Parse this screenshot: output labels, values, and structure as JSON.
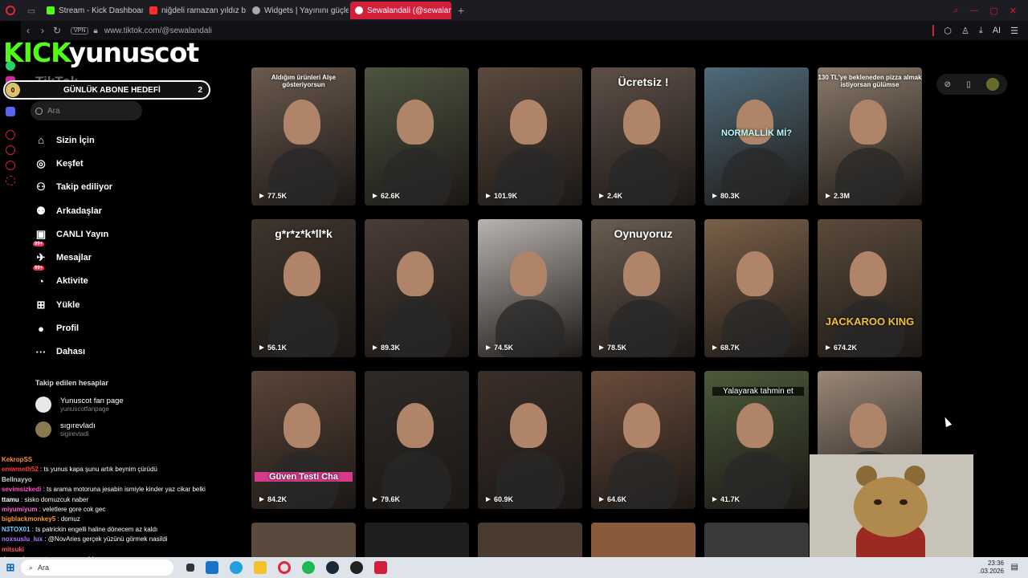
{
  "browser": {
    "tabs": [
      {
        "label": "Stream - Kick Dashboard",
        "color": "#53fc18"
      },
      {
        "label": "niğdeli ramazan yıldız bir b",
        "color": "#ff2d2d"
      },
      {
        "label": "Widgets | Yayınını güçlend",
        "color": "#cccccc"
      },
      {
        "label": "Sewalandali (@sewalandali",
        "color": "#ffffff"
      }
    ],
    "new_tab": "+",
    "vpn": "VPN",
    "url": "www.tiktok.com/@sewalandali",
    "ai_label": "AI"
  },
  "overlay": {
    "kick_logo": "KICK",
    "streamer": "yunuscot",
    "goal_label": "GÜNLÜK ABONE HEDEFİ",
    "goal_current": "0",
    "goal_target": "2"
  },
  "tiktok": {
    "brand": "TikTok",
    "search_placeholder": "Ara",
    "nav": [
      {
        "label": "Sizin İçin",
        "icon": "home-icon",
        "glyph": "⌂"
      },
      {
        "label": "Keşfet",
        "icon": "compass-icon",
        "glyph": "◎"
      },
      {
        "label": "Takip ediliyor",
        "icon": "following-icon",
        "glyph": "⚇"
      },
      {
        "label": "Arkadaşlar",
        "icon": "friends-icon",
        "glyph": "⚉"
      },
      {
        "label": "CANLI Yayın",
        "icon": "live-icon",
        "glyph": "▣"
      },
      {
        "label": "Mesajlar",
        "icon": "messages-icon",
        "glyph": "✈",
        "badge": "99+"
      },
      {
        "label": "Aktivite",
        "icon": "activity-icon",
        "glyph": "◔",
        "badge": "99+"
      },
      {
        "label": "Yükle",
        "icon": "upload-icon",
        "glyph": "⊞"
      },
      {
        "label": "Profil",
        "icon": "profile-icon",
        "glyph": "●"
      },
      {
        "label": "Dahası",
        "icon": "more-icon",
        "glyph": "···"
      }
    ],
    "following_title": "Takip edilen hesaplar",
    "accounts": [
      {
        "name": "Yunuscot fan page",
        "handle": "yunuscotfanpage"
      },
      {
        "name": "sıgırevladı",
        "handle": "sigirevladi"
      }
    ]
  },
  "videos": [
    {
      "views": "77.5K",
      "caption": "Aldığım ürünleri Alşe gösteriyorsun",
      "bg": "#6b5a4e"
    },
    {
      "views": "62.6K",
      "caption": "",
      "bg": "#4d5440"
    },
    {
      "views": "101.9K",
      "caption": "",
      "bg": "#5b4a3e"
    },
    {
      "views": "2.4K",
      "caption": "Ücretsiz !",
      "bg": "#5e5048"
    },
    {
      "views": "80.3K",
      "caption": "NORMALLİK Mİ?",
      "bg": "#4f6b7a"
    },
    {
      "views": "2.3M",
      "caption": "130 TL'ye bekleneden pizza almak istiyorsan gülümse",
      "bg": "#8a7a6a"
    },
    {
      "views": "56.1K",
      "caption": "g*r*z*k*ll*k",
      "bg": "#3e342c"
    },
    {
      "views": "89.3K",
      "caption": "",
      "bg": "#4a3c36"
    },
    {
      "views": "74.5K",
      "caption": "",
      "bg": "#b8b3ae"
    },
    {
      "views": "78.5K",
      "caption": "Oynuyoruz",
      "bg": "#6a5c50"
    },
    {
      "views": "68.7K",
      "caption": "",
      "bg": "#7a6048"
    },
    {
      "views": "674.2K",
      "caption": "JACKAROO KING",
      "bg": "#5a4a3a"
    },
    {
      "views": "84.2K",
      "caption": "Güven Testi Cha",
      "bg": "#5a4438"
    },
    {
      "views": "79.6K",
      "caption": "",
      "bg": "#2e2a28"
    },
    {
      "views": "60.9K",
      "caption": "",
      "bg": "#3a2e28"
    },
    {
      "views": "64.6K",
      "caption": "",
      "bg": "#6a4c3c"
    },
    {
      "views": "41.7K",
      "caption": "Yalayarak tahmin et",
      "bg": "#4a5a3a"
    },
    {
      "views": "",
      "caption": "",
      "bg": "#9a8878"
    }
  ],
  "chat": [
    {
      "user": "KekropSS",
      "text": "",
      "color": "#ff8c2a"
    },
    {
      "user": "emwmeth52",
      "text": "ts yunus kapa şunu artık beynim çürüdü",
      "color": "#ff3b3b"
    },
    {
      "user": "Bellnayyo",
      "text": "",
      "color": "#cccccc"
    },
    {
      "user": "sevimsizkedi",
      "text": "ts arama motoruna jesabin ismiyle kinder yaz cikar belki",
      "color": "#ff4fd0"
    },
    {
      "user": "ttamu",
      "text": "sisko domuzcuk naber",
      "color": "#ffffff"
    },
    {
      "user": "miyumiyum",
      "text": "veletlere gore cok gec",
      "color": "#ff66cc"
    },
    {
      "user": "bigblackmonkey5",
      "text": "domuz",
      "color": "#ff9a2a"
    },
    {
      "user": "N3TOX01",
      "text": "ts patrickin engelli haline dönecem az kaldı",
      "color": "#7ad0ff"
    },
    {
      "user": "noxsuslu_lux",
      "text": "@NovAries gerçek yüzünü görmek nasildi",
      "color": "#b07aff"
    },
    {
      "user": "mitsuki",
      "text": "",
      "color": "#ff5555"
    },
    {
      "user": "damnnbusra",
      "text": "ts ayıcı oynuyabim ma",
      "color": "#ff5555"
    }
  ],
  "taskbar": {
    "search_label": "Ara",
    "time": "23:36",
    "date": ".03.2026"
  }
}
